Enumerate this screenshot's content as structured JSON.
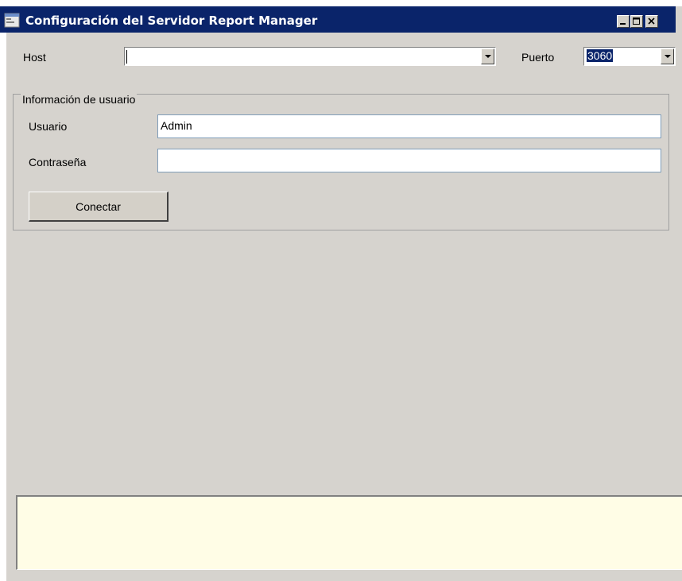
{
  "window": {
    "title": "Configuración del Servidor Report Manager",
    "icon": "app-window-icon",
    "controls": [
      "minimize-icon",
      "maximize-icon",
      "close-icon"
    ]
  },
  "connection": {
    "host_label": "Host",
    "host_value": "",
    "port_label": "Puerto",
    "port_value": "3060"
  },
  "user_group": {
    "legend": "Información de usuario",
    "user_label": "Usuario",
    "user_value": "Admin",
    "password_label": "Contraseña",
    "password_value": "",
    "connect_label": "Conectar"
  },
  "status": {
    "text": ""
  },
  "colors": {
    "titlebar": "#0a246a",
    "window_bg": "#d6d3ce",
    "status_bg": "#fffde6"
  }
}
